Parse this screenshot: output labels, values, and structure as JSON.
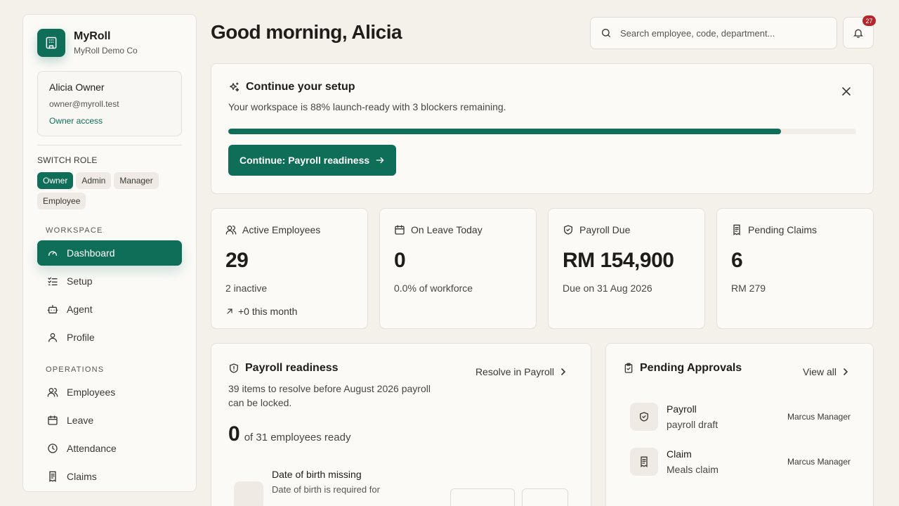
{
  "brand": {
    "name": "MyRoll",
    "company": "MyRoll Demo Co"
  },
  "user": {
    "name": "Alicia Owner",
    "email": "owner@myroll.test",
    "access": "Owner access"
  },
  "roles": {
    "label": "SWITCH ROLE",
    "items": [
      "Owner",
      "Admin",
      "Manager",
      "Employee"
    ],
    "active": "Owner"
  },
  "nav": {
    "workspace_label": "WORKSPACE",
    "workspace": [
      {
        "label": "Dashboard",
        "icon": "gauge-icon",
        "active": true
      },
      {
        "label": "Setup",
        "icon": "checklist-icon"
      },
      {
        "label": "Agent",
        "icon": "bot-icon"
      },
      {
        "label": "Profile",
        "icon": "user-icon"
      }
    ],
    "operations_label": "OPERATIONS",
    "operations": [
      {
        "label": "Employees",
        "icon": "users-icon"
      },
      {
        "label": "Leave",
        "icon": "calendar-icon"
      },
      {
        "label": "Attendance",
        "icon": "clock-icon"
      },
      {
        "label": "Claims",
        "icon": "receipt-icon"
      }
    ]
  },
  "header": {
    "greeting": "Good morning, Alicia",
    "search_placeholder": "Search employee, code, department...",
    "notification_count": "27"
  },
  "setup": {
    "title": "Continue your setup",
    "description": "Your workspace is 88% launch-ready with 3 blockers remaining.",
    "progress": 0.88,
    "cta": "Continue: Payroll readiness"
  },
  "stats": [
    {
      "label": "Active Employees",
      "value": "29",
      "sub": "2 inactive",
      "trend": "+0 this month",
      "icon": "users-icon"
    },
    {
      "label": "On Leave Today",
      "value": "0",
      "sub": "0.0% of workforce",
      "icon": "calendar-icon"
    },
    {
      "label": "Payroll Due",
      "value": "RM 154,900",
      "sub": "Due on 31 Aug 2026",
      "icon": "shield-check-icon"
    },
    {
      "label": "Pending Claims",
      "value": "6",
      "sub": "RM 279",
      "icon": "receipt-icon"
    }
  ],
  "readiness": {
    "title": "Payroll readiness",
    "link": "Resolve in Payroll",
    "description": "39 items to resolve before August 2026 payroll can be locked.",
    "ready_count": "0",
    "ready_of": "of 31 employees ready",
    "issue": {
      "title": "Date of birth missing",
      "description": "Date of birth is required for"
    }
  },
  "approvals": {
    "title": "Pending Approvals",
    "view_all": "View all",
    "items": [
      {
        "type": "Payroll",
        "description": "payroll draft",
        "requester": "Marcus Manager",
        "icon": "shield-check-icon"
      },
      {
        "type": "Claim",
        "description": "Meals claim",
        "requester": "Marcus Manager",
        "icon": "receipt-icon"
      }
    ]
  },
  "colors": {
    "accent": "#0f6e58",
    "badge": "#b3262b",
    "background": "#f4f0ea",
    "card": "#fbfaf7"
  }
}
